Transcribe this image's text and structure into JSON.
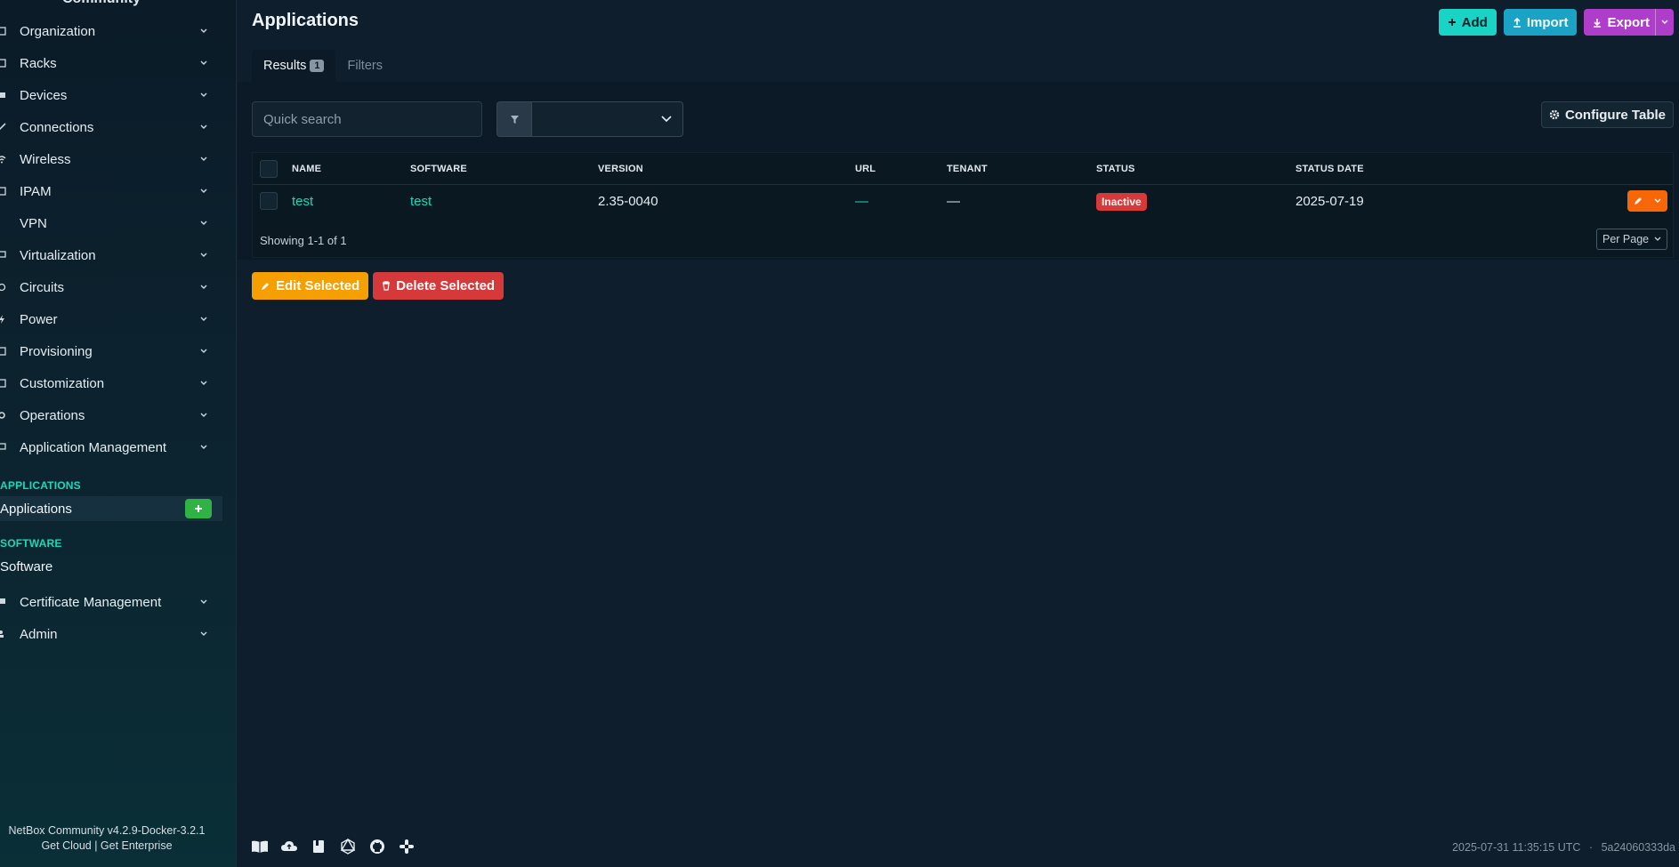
{
  "sidebar": {
    "brand_peek": "Community",
    "nav": [
      {
        "label": "Organization",
        "icon": "organization-icon"
      },
      {
        "label": "Racks",
        "icon": "rack-icon"
      },
      {
        "label": "Devices",
        "icon": "devices-icon"
      },
      {
        "label": "Connections",
        "icon": "connections-icon"
      },
      {
        "label": "Wireless",
        "icon": "wireless-icon"
      },
      {
        "label": "IPAM",
        "icon": "ipam-icon"
      },
      {
        "label": "VPN",
        "icon": "vpn-icon"
      },
      {
        "label": "Virtualization",
        "icon": "virtualization-icon"
      },
      {
        "label": "Circuits",
        "icon": "circuits-icon"
      },
      {
        "label": "Power",
        "icon": "power-icon"
      },
      {
        "label": "Provisioning",
        "icon": "provisioning-icon"
      },
      {
        "label": "Customization",
        "icon": "customization-icon"
      },
      {
        "label": "Operations",
        "icon": "operations-icon"
      },
      {
        "label": "Application Management",
        "icon": "app-management-icon"
      }
    ],
    "sections": {
      "applications_head": "APPLICATIONS",
      "applications_item": "Applications",
      "software_head": "SOFTWARE",
      "software_item": "Software"
    },
    "nav_bottom": [
      {
        "label": "Certificate Management",
        "icon": "certificate-icon"
      },
      {
        "label": "Admin",
        "icon": "admin-icon"
      }
    ],
    "footer": {
      "version": "NetBox Community v4.2.9-Docker-3.2.1",
      "links": "Get Cloud | Get Enterprise"
    }
  },
  "page": {
    "title": "Applications",
    "actions": {
      "add": "Add",
      "import": "Import",
      "export": "Export"
    },
    "tabs": {
      "results": "Results",
      "results_count": "1",
      "filters": "Filters"
    },
    "search": {
      "placeholder": "Quick search"
    },
    "configure_table": "Configure Table"
  },
  "table": {
    "headers": [
      "NAME",
      "SOFTWARE",
      "VERSION",
      "URL",
      "TENANT",
      "STATUS",
      "STATUS DATE"
    ],
    "rows": [
      {
        "name": "test",
        "software": "test",
        "version": "2.35-0040",
        "url": "—",
        "tenant": "—",
        "status": "Inactive",
        "status_date": "2025-07-19"
      }
    ],
    "showing": "Showing 1-1 of 1",
    "per_page": "Per Page"
  },
  "bulk": {
    "edit": "Edit Selected",
    "delete": "Delete Selected"
  },
  "footer": {
    "timestamp": "2025-07-31 11:35:15 UTC",
    "separator": "·",
    "commit": "5a24060333da"
  },
  "colors": {
    "accent": "#1ad9b8",
    "danger": "#d63939",
    "warning": "#f59f00",
    "orange": "#f76707",
    "purple": "#ae3ec9",
    "cyan": "#1ba3c6"
  }
}
